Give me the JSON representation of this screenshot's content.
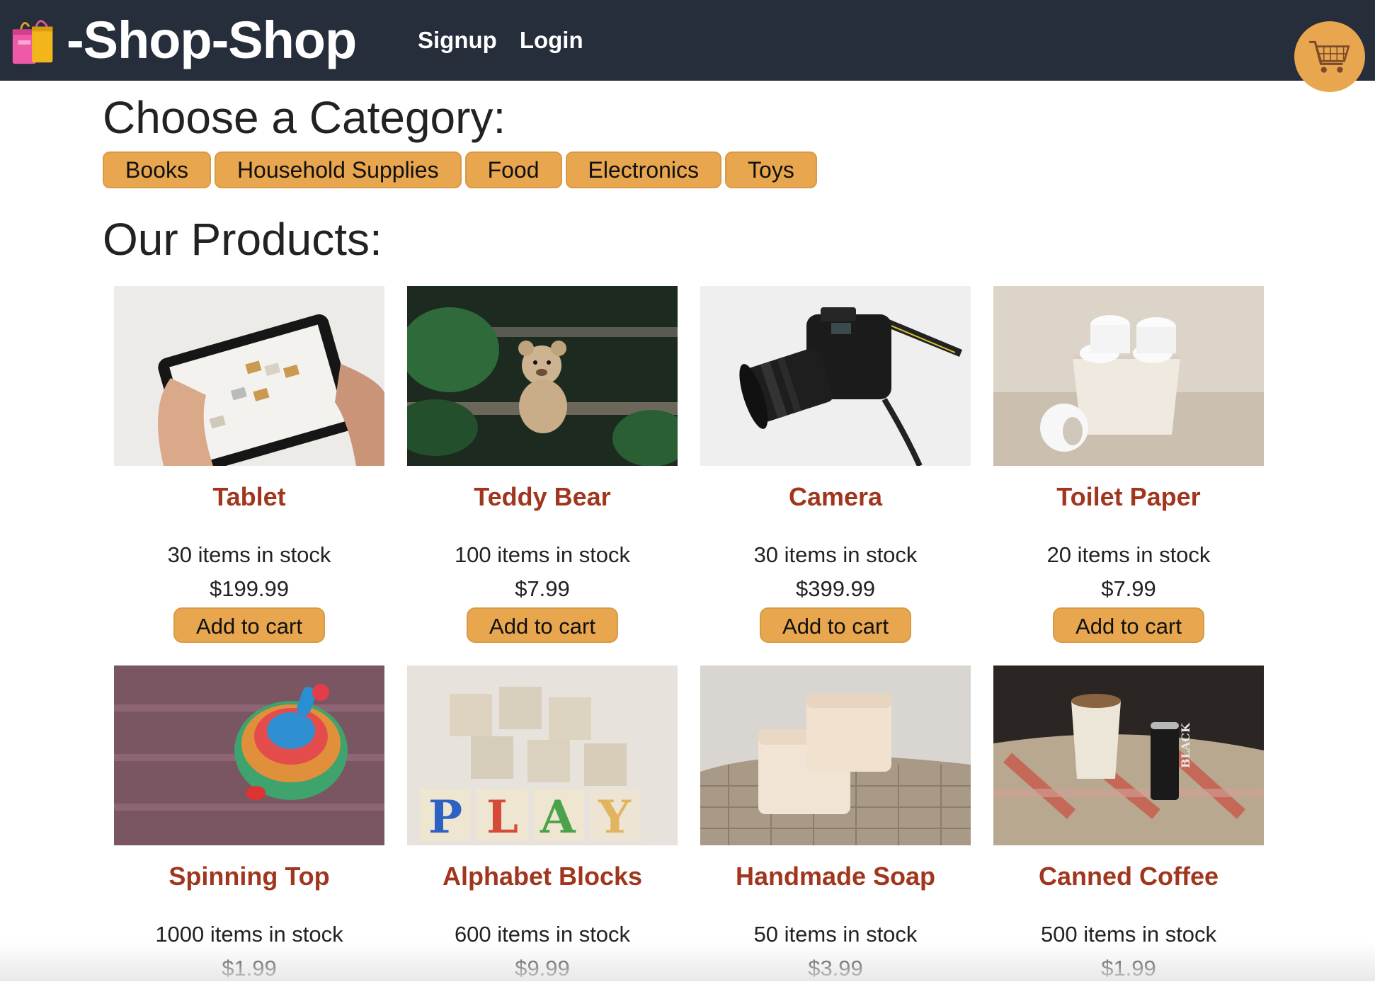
{
  "header": {
    "brand": "-Shop-Shop",
    "brand_icon": "shopping-bags-icon",
    "nav": [
      {
        "label": "Signup"
      },
      {
        "label": "Login"
      }
    ],
    "cart_icon": "shopping-cart-icon"
  },
  "categories": {
    "title": "Choose a Category:",
    "items": [
      "Books",
      "Household Supplies",
      "Food",
      "Electronics",
      "Toys"
    ]
  },
  "products": {
    "title": "Our Products:",
    "add_label": "Add to cart",
    "items": [
      {
        "name": "Tablet",
        "stock": "30 items in stock",
        "price": "$199.99",
        "image": "tablet-photo"
      },
      {
        "name": "Teddy Bear",
        "stock": "100 items in stock",
        "price": "$7.99",
        "image": "teddy-bear-photo"
      },
      {
        "name": "Camera",
        "stock": "30 items in stock",
        "price": "$399.99",
        "image": "camera-photo"
      },
      {
        "name": "Toilet Paper",
        "stock": "20 items in stock",
        "price": "$7.99",
        "image": "toilet-paper-photo"
      },
      {
        "name": "Spinning Top",
        "stock": "1000 items in stock",
        "price": "$1.99",
        "image": "spinning-top-photo"
      },
      {
        "name": "Alphabet Blocks",
        "stock": "600 items in stock",
        "price": "$9.99",
        "image": "alphabet-blocks-photo"
      },
      {
        "name": "Handmade Soap",
        "stock": "50 items in stock",
        "price": "$3.99",
        "image": "soap-photo"
      },
      {
        "name": "Canned Coffee",
        "stock": "500 items in stock",
        "price": "$1.99",
        "image": "canned-coffee-photo"
      }
    ]
  },
  "colors": {
    "header_bg": "#262d3b",
    "accent": "#e8a64f",
    "product_name": "#a1361e"
  }
}
